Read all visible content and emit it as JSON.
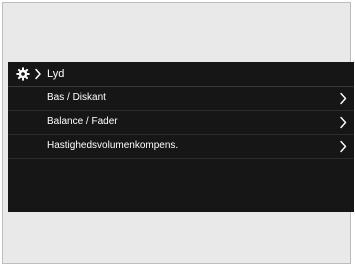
{
  "header": {
    "icon": "gear-icon",
    "separator_icon": "chevron-right-icon",
    "title": "Lyd"
  },
  "menu": {
    "items": [
      {
        "label": "Bas / Diskant",
        "icon": "chevron-right-icon"
      },
      {
        "label": "Balance / Fader",
        "icon": "chevron-right-icon"
      },
      {
        "label": "Hastighedsvolumenkompens.",
        "icon": "chevron-right-icon"
      }
    ]
  },
  "colors": {
    "screen_background": "#161616",
    "text": "#ffffff",
    "frame_background": "#e9e9e9"
  }
}
